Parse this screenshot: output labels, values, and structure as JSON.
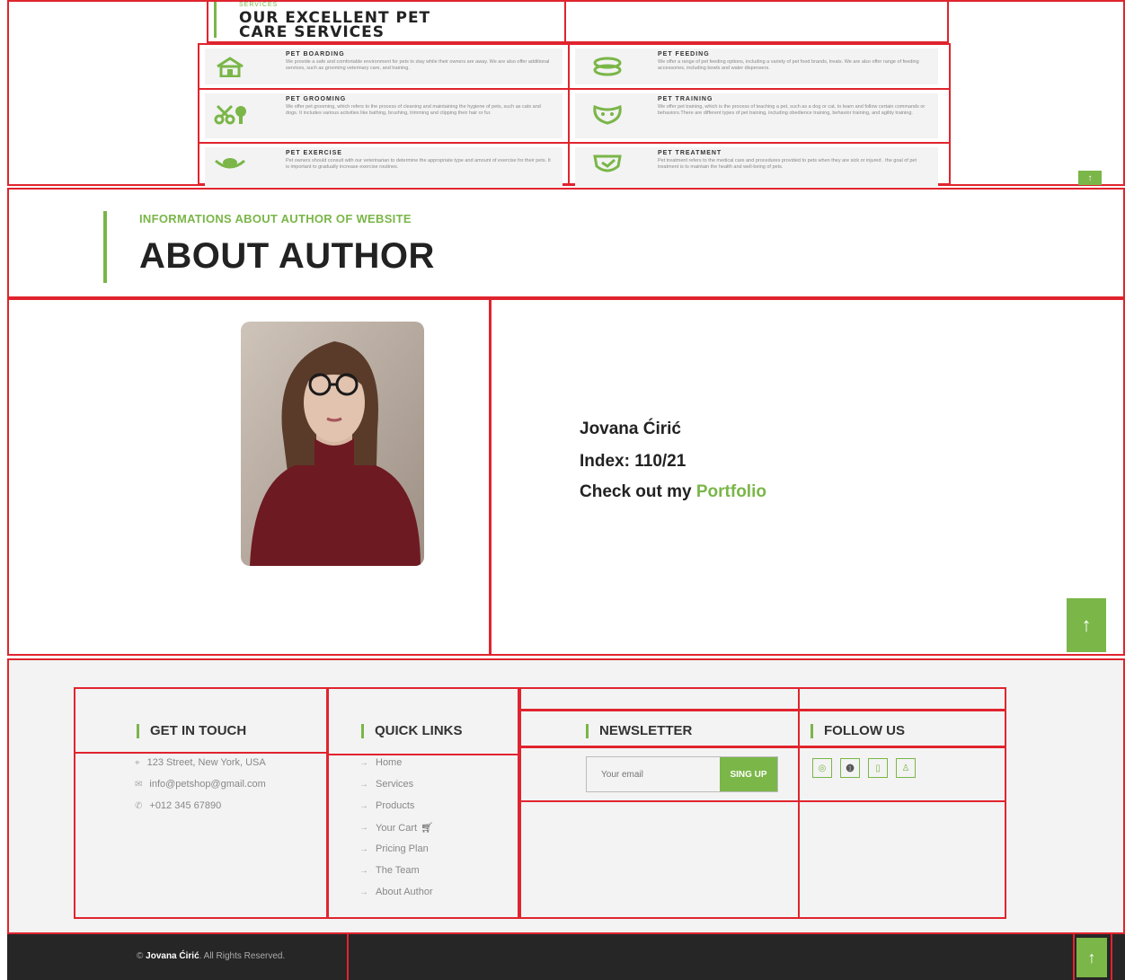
{
  "services": {
    "eyebrow": "SERVICES",
    "title_line1": "OUR EXCELLENT PET",
    "title_line2": "CARE SERVICES",
    "items": [
      {
        "name": "PET BOARDING",
        "icon": "house-icon",
        "desc": "We provide a safe and comfortable environment for pets to stay while their owners are away. We are also offer additional services, such as grooming veterinary care, and training."
      },
      {
        "name": "PET FEEDING",
        "icon": "food-icon",
        "desc": "We offer a range of pet feeding options, including a variety of pet food brands, treats. We are also offer range of feeding accessories, including bowls and water dispensers."
      },
      {
        "name": "PET GROOMING",
        "icon": "scissors-icon",
        "desc": "We offer pet grooming, which refers to the process of cleaning and maintaining the hygiene of pets, such as cats and dogs. It includes various activities like bathing, brushing, trimming and clipping their hair or fur."
      },
      {
        "name": "PET TRAINING",
        "icon": "cat-icon",
        "desc": "We offer pet training, which is the process of teaching a pet, such as a dog or cat, to learn and follow certain commands or behaviors.There are different types of pet training, including obedience training, behavior training, and agility training."
      },
      {
        "name": "PET EXERCISE",
        "icon": "hands-icon",
        "desc": "Pet owners should consult with our veterinarian to determine the appropriate type and amount of exercise for their pets. It is important to gradually increase exercise routines."
      },
      {
        "name": "PET TREATMENT",
        "icon": "shield-icon",
        "desc": "Pet treatment refers to the medical care and procedures provided to pets when they are sick or injured . the goal of pet treatment is to maintain the health and well-being of pets."
      }
    ]
  },
  "about": {
    "eyebrow": "INFORMATIONS ABOUT AUTHOR OF WEBSITE",
    "title": "ABOUT AUTHOR",
    "name": "Jovana Ćirić",
    "index": "Index: 110/21",
    "portfolio_prefix": "Check out my",
    "portfolio_link": "Portfolio"
  },
  "footer": {
    "contact": {
      "heading": "GET IN TOUCH",
      "address": "123 Street, New York, USA",
      "email": "info@petshop@gmail.com",
      "phone": "+012 345 67890"
    },
    "links": {
      "heading": "QUICK LINKS",
      "items": [
        "Home",
        "Services",
        "Products",
        "Your Cart",
        "Pricing Plan",
        "The Team",
        "About Author"
      ]
    },
    "newsletter": {
      "heading": "NEWSLETTER",
      "placeholder": "Your email",
      "button": "SING UP"
    },
    "social": {
      "heading": "FOLLOW US",
      "icons": [
        "instagram-icon",
        "facebook-icon",
        "mobile-icon",
        "user-icon"
      ]
    },
    "copyright_owner": "Jovana Ćirić",
    "copyright_rest": "All Rights Reserved.",
    "copyright_symbol": "©"
  },
  "back_to_top_label": "↑",
  "colors": {
    "accent": "#7ab648",
    "outline": "#e0242e",
    "dark": "#262626"
  }
}
